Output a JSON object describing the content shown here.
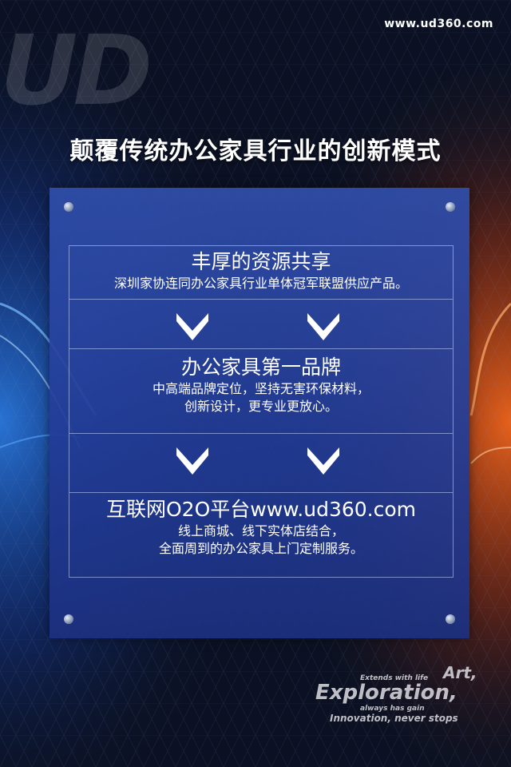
{
  "site": {
    "url": "www.ud360.com"
  },
  "brand": {
    "logo_text": "UD"
  },
  "headline": "颠覆传统办公家具行业的创新模式",
  "sections": [
    {
      "title": "丰厚的资源共享",
      "lines": [
        "深圳家协连同办公家具行业单体冠军联盟供应产品。"
      ]
    },
    {
      "title": "办公家具第一品牌",
      "lines": [
        "中高端品牌定位，坚持无害环保材料，",
        "创新设计，更专业更放心。"
      ]
    },
    {
      "title": "互联网O2O平台www.ud360.com",
      "lines": [
        "线上商城、线下实体店结合，",
        "全面周到的办公家具上门定制服务。"
      ]
    }
  ],
  "slogan": {
    "line1": "Extends with life",
    "line2": "Art,",
    "line3": "Exploration,",
    "line4": "always has gain",
    "line5": "Innovation, never stops"
  },
  "icons": {
    "arrow": "chevron-down-icon",
    "screw": "screw-icon"
  },
  "colors": {
    "panel": "#2b47a0",
    "frame_line": "#c8d7ff",
    "text": "#ffffff",
    "glow_left": "#2f8cff",
    "glow_right": "#ff5a1a"
  }
}
